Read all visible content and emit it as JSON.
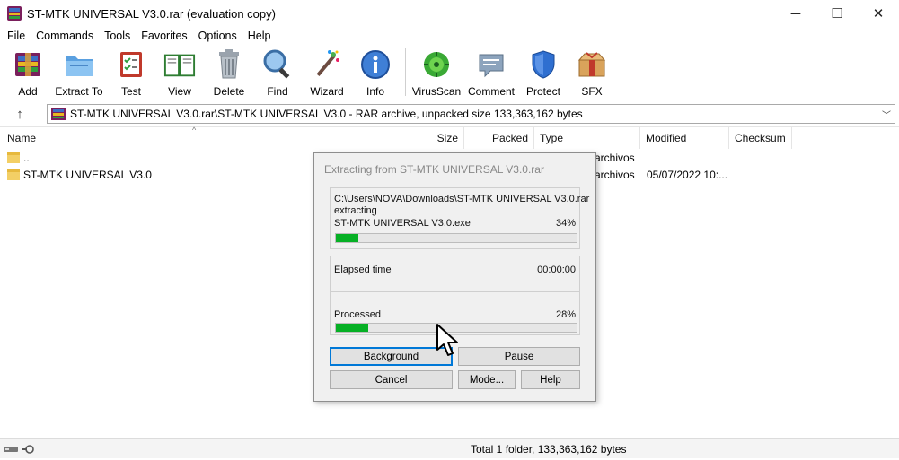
{
  "window": {
    "title": "ST-MTK UNIVERSAL V3.0.rar (evaluation copy)",
    "minimize": "─",
    "maximize": "☐",
    "close": "✕"
  },
  "menu": [
    "File",
    "Commands",
    "Tools",
    "Favorites",
    "Options",
    "Help"
  ],
  "toolbar": [
    {
      "label": "Add",
      "icon": "add-archive-icon"
    },
    {
      "label": "Extract To",
      "icon": "extract-folder-icon"
    },
    {
      "label": "Test",
      "icon": "test-checklist-icon"
    },
    {
      "label": "View",
      "icon": "view-book-icon"
    },
    {
      "label": "Delete",
      "icon": "trash-icon"
    },
    {
      "label": "Find",
      "icon": "magnifier-icon"
    },
    {
      "label": "Wizard",
      "icon": "wizard-wand-icon"
    },
    {
      "label": "Info",
      "icon": "info-icon"
    },
    {
      "label": "VirusScan",
      "icon": "virus-scan-icon"
    },
    {
      "label": "Comment",
      "icon": "comment-icon"
    },
    {
      "label": "Protect",
      "icon": "shield-icon"
    },
    {
      "label": "SFX",
      "icon": "sfx-box-icon"
    }
  ],
  "address": {
    "up": "↑",
    "path": "ST-MTK UNIVERSAL V3.0.rar\\ST-MTK UNIVERSAL V3.0 - RAR archive, unpacked size 133,363,162 bytes",
    "dropdown": "﹀"
  },
  "columns": {
    "name": "Name",
    "size": "Size",
    "packed": "Packed",
    "type": "Type",
    "modified": "Modified",
    "checksum": "Checksum",
    "sort": "^"
  },
  "rows": [
    {
      "name": "..",
      "size": "",
      "packed": "",
      "type": "archivos",
      "modified": "",
      "checksum": ""
    },
    {
      "name": "ST-MTK UNIVERSAL V3.0",
      "size": "",
      "packed": "",
      "type": "archivos",
      "modified": "05/07/2022 10:...",
      "checksum": ""
    }
  ],
  "status": {
    "text": "Total 1 folder, 133,363,162 bytes"
  },
  "dialog": {
    "title": "Extracting from ST-MTK UNIVERSAL V3.0.rar",
    "source_path": "C:\\Users\\NOVA\\Downloads\\ST-MTK UNIVERSAL V3.0.rar",
    "action": "extracting",
    "current_file": "ST-MTK UNIVERSAL V3.0.exe",
    "file_percent_text": "34%",
    "file_progress": 0.095,
    "elapsed_label": "Elapsed time",
    "elapsed_value": "00:00:00",
    "processed_label": "Processed",
    "processed_percent_text": "28%",
    "processed_progress": 0.135,
    "buttons": {
      "background": "Background",
      "pause": "Pause",
      "cancel": "Cancel",
      "mode": "Mode...",
      "help": "Help"
    }
  },
  "colors": {
    "progress_fill": "#06b025",
    "focus_border": "#0078d7"
  }
}
